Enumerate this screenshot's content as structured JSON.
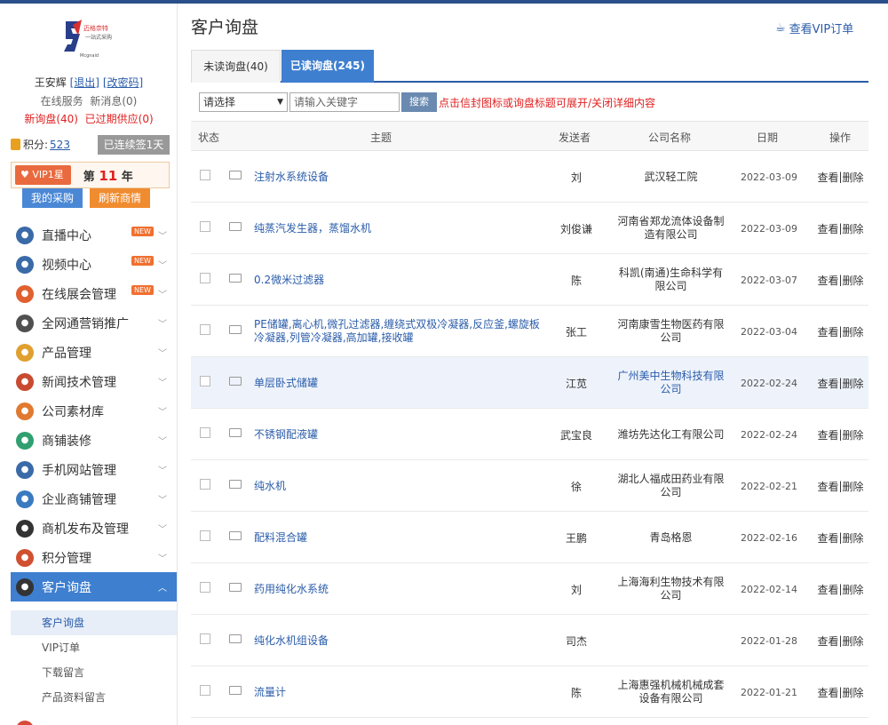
{
  "brand": {
    "logo_text": "迈格奈特",
    "logo_sub": "一站式采购"
  },
  "user": {
    "name": "王安辉",
    "logout": "[退出]",
    "change_pwd": "[改密码]"
  },
  "service": {
    "online": "在线服务",
    "new_msg": "新消息(0)"
  },
  "alerts": {
    "new_inquiry": "新询盘(40)",
    "expired": "已过期供应(0)"
  },
  "points": {
    "label": "积分:",
    "value": "523",
    "signed": "已连续签1天"
  },
  "vip": {
    "badge": "VIP1星",
    "year_prefix": "第",
    "year": "11",
    "year_suffix": "年"
  },
  "actions": {
    "purchase": "我的采购",
    "refresh": "刷新商情"
  },
  "menu": [
    {
      "label": "直播中心",
      "icon": "live-icon",
      "color": "#3a6aa8",
      "new": true
    },
    {
      "label": "视频中心",
      "icon": "video-icon",
      "color": "#3a6aa8",
      "new": true
    },
    {
      "label": "在线展会管理",
      "icon": "expo-icon",
      "color": "#e06030",
      "new": true
    },
    {
      "label": "全网通营销推广",
      "icon": "promo-icon",
      "color": "#505050",
      "new": false
    },
    {
      "label": "产品管理",
      "icon": "basket-icon",
      "color": "#e0a030",
      "new": false
    },
    {
      "label": "新闻技术管理",
      "icon": "news-icon",
      "color": "#c84a30",
      "new": false
    },
    {
      "label": "公司素材库",
      "icon": "camera-icon",
      "color": "#e07a30",
      "new": false
    },
    {
      "label": "商铺装修",
      "icon": "brush-icon",
      "color": "#30a070",
      "new": false
    },
    {
      "label": "手机网站管理",
      "icon": "phone-icon",
      "color": "#3a6aa8",
      "new": false
    },
    {
      "label": "企业商铺管理",
      "icon": "shop-icon",
      "color": "#3a7ac0",
      "new": false
    },
    {
      "label": "商机发布及管理",
      "icon": "biz-icon",
      "color": "#333333",
      "new": false
    },
    {
      "label": "积分管理",
      "icon": "points-icon",
      "color": "#d05030",
      "new": false
    },
    {
      "label": "客户询盘",
      "icon": "inquiry-icon",
      "color": "#333333",
      "new": false
    }
  ],
  "new_tag": "NEW",
  "submenu": [
    "客户询盘",
    "VIP订单",
    "下载留言",
    "产品资料留言"
  ],
  "page": {
    "title": "客户询盘",
    "vip_order": "查看VIP订单"
  },
  "tabs": {
    "unread": "未读询盘(40)",
    "read": "已读询盘(245)"
  },
  "filter": {
    "select": "请选择",
    "placeholder": "请输入关键字",
    "button": "搜索",
    "hint": "点击信封图标或询盘标题可展开/关闭详细内容"
  },
  "columns": {
    "status": "状态",
    "subject": "主题",
    "sender": "发送者",
    "company": "公司名称",
    "date": "日期",
    "ops": "操作"
  },
  "rows": [
    {
      "subject": "注射水系统设备",
      "sender": "刘",
      "company": "武汉轻工院",
      "date": "2022-03-09"
    },
    {
      "subject": "纯蒸汽发生器，蒸馏水机",
      "sender": "刘俊谦",
      "company": "河南省郑龙流体设备制造有限公司",
      "date": "2022-03-09"
    },
    {
      "subject": "0.2微米过滤器",
      "sender": "陈",
      "company": "科凯(南通)生命科学有限公司",
      "date": "2022-03-07"
    },
    {
      "subject": "PE储罐,离心机,微孔过滤器,缠绕式双极冷凝器,反应釜,螺旋板冷凝器,列管冷凝器,高加罐,接收罐",
      "sender": "张工",
      "company": "河南康雪生物医药有限公司",
      "date": "2022-03-04"
    },
    {
      "subject": "单层卧式储罐",
      "sender": "江苋",
      "company": "广州美中生物科技有限公司",
      "date": "2022-02-24"
    },
    {
      "subject": "不锈钢配液罐",
      "sender": "武宝良",
      "company": "潍坊先达化工有限公司",
      "date": "2022-02-24"
    },
    {
      "subject": "纯水机",
      "sender": "徐",
      "company": "湖北人福成田药业有限公司",
      "date": "2022-02-21"
    },
    {
      "subject": "配料混合罐",
      "sender": "王鹏",
      "company": "青岛格恩",
      "date": "2022-02-16"
    },
    {
      "subject": "药用纯化水系统",
      "sender": "刘",
      "company": "上海海利生物技术有限公司",
      "date": "2022-02-14"
    },
    {
      "subject": "纯化水机组设备",
      "sender": "司杰",
      "company": "",
      "date": "2022-01-28"
    },
    {
      "subject": "流量计",
      "sender": "陈",
      "company": "上海惠强机械机械成套设备有限公司",
      "date": "2022-01-21"
    }
  ],
  "ops": {
    "view": "查看",
    "sep": "|",
    "delete": "删除"
  }
}
